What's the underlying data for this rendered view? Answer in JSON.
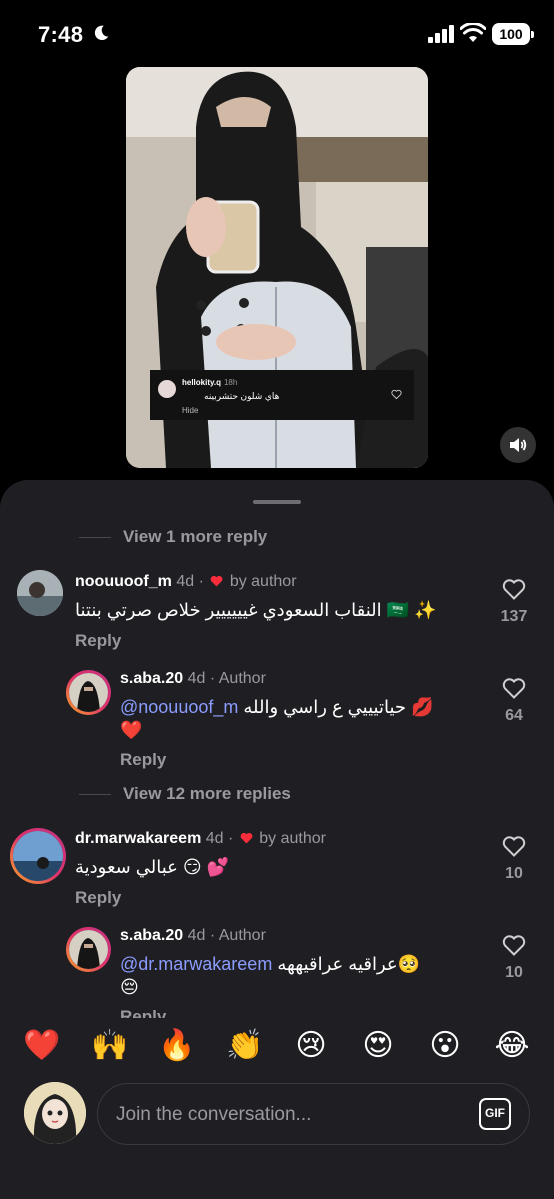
{
  "status_bar": {
    "time": "7:48",
    "battery": "100"
  },
  "video": {
    "sticker": {
      "username": "hellokity.q",
      "time": "18h",
      "text": "هاي شلون حتشربينه",
      "hide_label": "Hide"
    }
  },
  "comments": {
    "view_more_top": "View 1 more reply",
    "items": [
      {
        "username": "noouuoof_m",
        "age": "4d",
        "tag": "by author",
        "text": "النقاب السعودي غيييييير خلاص صرتي بنتنا 🇸🇦 ✨",
        "reply_label": "Reply",
        "likes": "137"
      },
      {
        "username": "s.aba.20",
        "age": "4d",
        "tag": "Author",
        "mention": "@noouuoof_m",
        "text": "حياتيييي ع راسي والله 💋",
        "text2": "❤️",
        "reply_label": "Reply",
        "likes": "64"
      },
      {
        "username": "dr.marwakareem",
        "age": "4d",
        "tag": "by author",
        "text": "عبالي سعودية 😏 💕",
        "reply_label": "Reply",
        "likes": "10"
      },
      {
        "username": "s.aba.20",
        "age": "4d",
        "tag": "Author",
        "mention": "@dr.marwakareem",
        "text": "عراقيه عراقيههه🥺",
        "text2": "😔",
        "reply_label": "Reply",
        "likes": "10"
      }
    ],
    "view_more_mid": "View 12 more replies",
    "separator": "·"
  },
  "emoji_bar": [
    "❤️",
    "🙌",
    "🔥",
    "👏",
    "😢",
    "😍",
    "😮",
    "😂"
  ],
  "composer": {
    "placeholder": "Join the conversation...",
    "gif_label": "GIF"
  },
  "colors": {
    "sheet_bg": "#1f1f23",
    "mention": "#8b9cff",
    "heart": "#ff2d3b"
  }
}
